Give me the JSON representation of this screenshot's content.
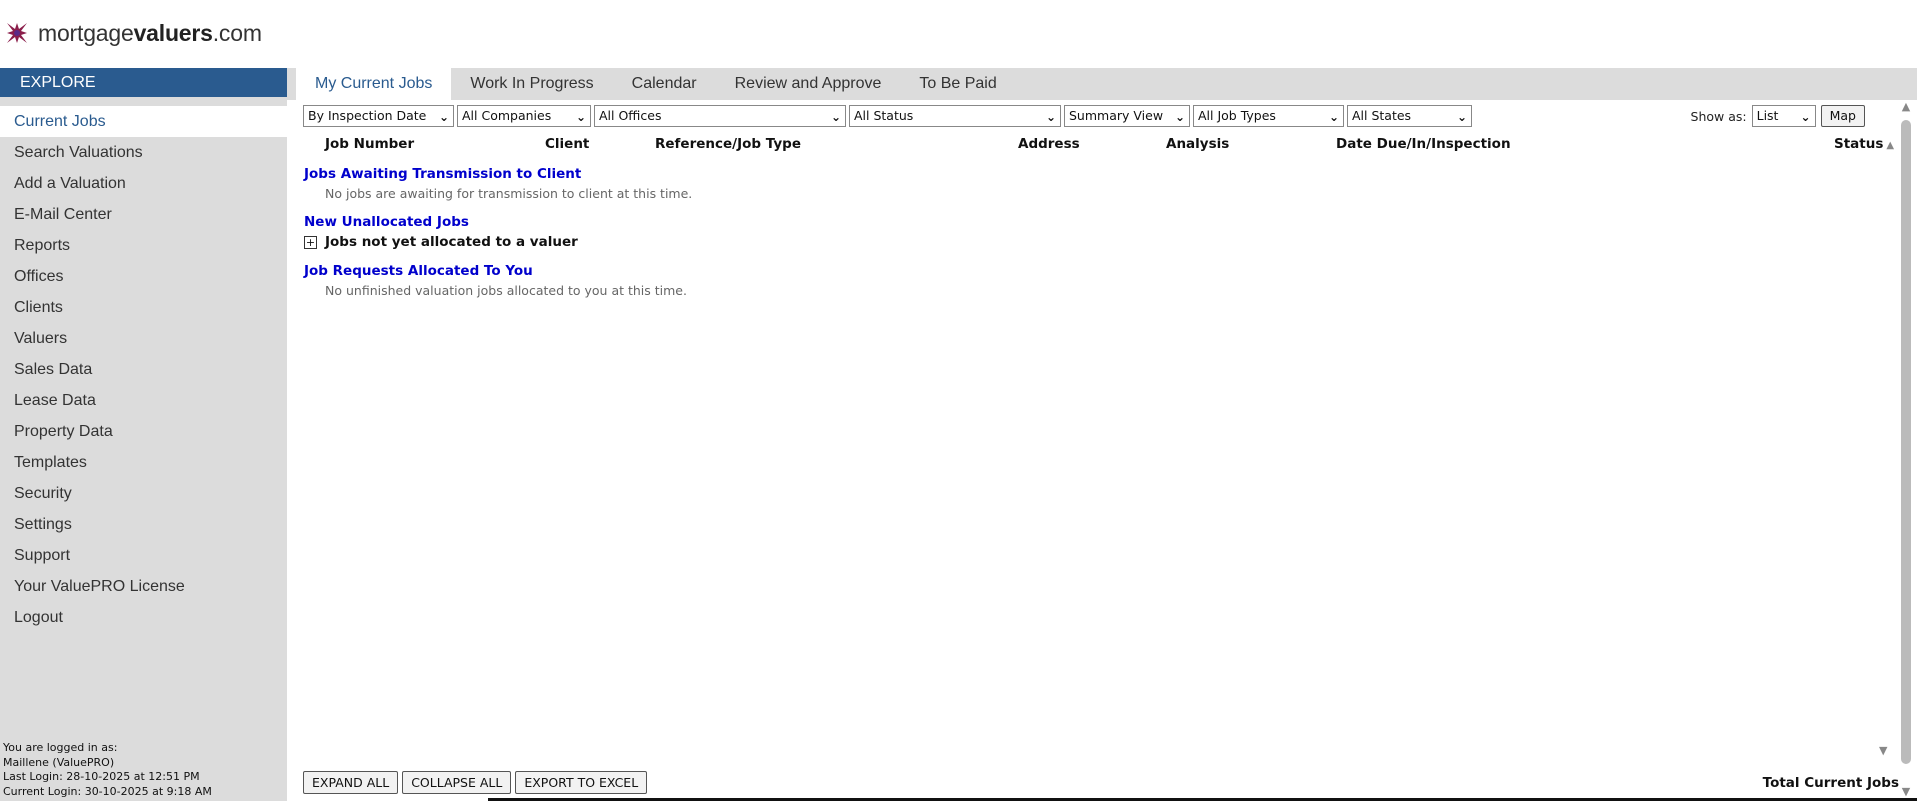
{
  "brand": {
    "prefix": "mortgage",
    "bold": "valuers",
    "suffix": ".com",
    "accent": "#8b1e4b"
  },
  "sidebar": {
    "header": "EXPLORE",
    "items": [
      {
        "label": "Current Jobs",
        "active": true
      },
      {
        "label": "Search Valuations"
      },
      {
        "label": "Add a Valuation"
      },
      {
        "label": "E-Mail Center"
      },
      {
        "label": "Reports"
      },
      {
        "label": "Offices"
      },
      {
        "label": "Clients"
      },
      {
        "label": "Valuers"
      },
      {
        "label": "Sales Data"
      },
      {
        "label": "Lease Data"
      },
      {
        "label": "Property Data"
      },
      {
        "label": "Templates"
      },
      {
        "label": "Security"
      },
      {
        "label": "Settings"
      },
      {
        "label": "Support"
      },
      {
        "label": "Your ValuePRO License"
      },
      {
        "label": "Logout"
      }
    ],
    "login": {
      "line1": "You are logged in as:",
      "line2": "Maillene (ValuePRO)",
      "line3": "Last Login: 28-10-2025 at 12:51 PM",
      "line4": "Current Login: 30-10-2025 at 9:18 AM"
    }
  },
  "tabs": [
    "My Current Jobs",
    "Work In Progress",
    "Calendar",
    "Review and Approve",
    "To Be Paid"
  ],
  "filters": {
    "sort": "By Inspection Date",
    "companies": "All Companies",
    "offices": "All Offices",
    "status": "All Status",
    "view": "Summary View",
    "job_types": "All Job Types",
    "states": "All States"
  },
  "show_as": {
    "label": "Show as:",
    "value": "List",
    "map_button": "Map"
  },
  "columns": {
    "job_number": "Job Number",
    "client": "Client",
    "reference": "Reference/Job Type",
    "address": "Address",
    "analysis": "Analysis",
    "date": "Date Due/In/Inspection",
    "status": "Status"
  },
  "sections": {
    "awaiting_title": "Jobs Awaiting Transmission to Client",
    "awaiting_note": "No jobs are awaiting for transmission to client at this time.",
    "unallocated_title": "New Unallocated Jobs",
    "unallocated_expander": "Jobs not yet allocated to a valuer",
    "allocated_title": "Job Requests Allocated To You",
    "allocated_note": "No unfinished valuation jobs allocated to you at this time."
  },
  "bottom": {
    "expand_all": "EXPAND ALL",
    "collapse_all": "COLLAPSE ALL",
    "export": "EXPORT TO EXCEL",
    "total": "Total Current Jobs"
  }
}
